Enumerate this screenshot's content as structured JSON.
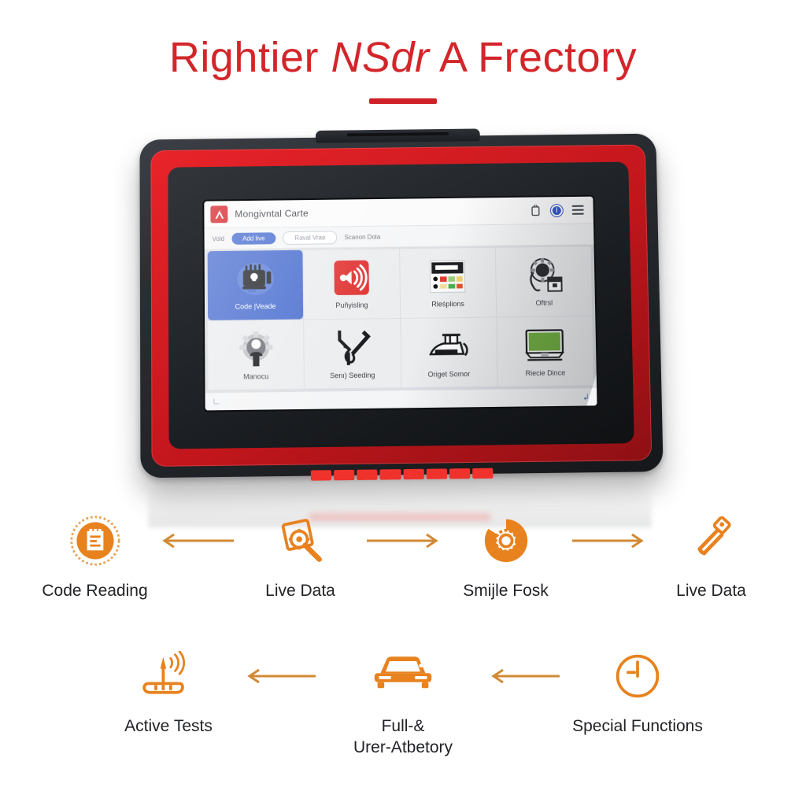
{
  "header": {
    "title_part1": "Rightier ",
    "title_italic": "NSdr",
    "title_part2": " A Frectory",
    "title_full": "Rightier NSdr A Frectory",
    "accent_color": "#d2262a"
  },
  "device": {
    "body_color": "#25282c",
    "trim_color": "#d8232a"
  },
  "app": {
    "logo_name": "brand-logo",
    "title": "Mongivntal Carte",
    "toolbar": [
      {
        "name": "clipboard-icon",
        "label": "clipboard"
      },
      {
        "name": "power-icon",
        "label": "power"
      },
      {
        "name": "menu-icon",
        "label": "menu"
      }
    ],
    "tabbar": {
      "lead_label": "Vold",
      "active_tab": "Add live",
      "ghost_tab": "Raval Vrae",
      "plain_tab": "Scanon Dola"
    },
    "tiles": [
      {
        "label": "Code |Veade",
        "icon": "ecu-module-icon",
        "selected": true
      },
      {
        "label": "Puñyisling",
        "icon": "broadcast-icon",
        "selected": false
      },
      {
        "label": "Rleśplions",
        "icon": "fuse-panel-icon",
        "selected": false
      },
      {
        "label": "Oftrsl",
        "icon": "fan-tool-icon",
        "selected": false
      },
      {
        "label": "Manocu",
        "icon": "gear-person-icon",
        "selected": false
      },
      {
        "label": "Senı) Seeding",
        "icon": "wrench-icon",
        "selected": false
      },
      {
        "label": "Origet Somor",
        "icon": "car-sensor-icon",
        "selected": false
      },
      {
        "label": "Riecie Dince",
        "icon": "monitor-icon",
        "selected": false
      }
    ],
    "statusbar": {
      "left_icon": "corner-left-icon",
      "right_icon": "enter-return-icon"
    }
  },
  "flow": {
    "accent_color": "#e8821e",
    "row1": [
      {
        "label": "Code Reading",
        "icon": "code-badge-icon"
      },
      {
        "arrow": "arrow-left"
      },
      {
        "label": "Live Data",
        "icon": "magnifier-gear-icon"
      },
      {
        "arrow": "arrow-right"
      },
      {
        "label": "Smijle Fosk",
        "icon": "gear-settings-icon"
      },
      {
        "arrow": "arrow-right"
      },
      {
        "label": "Live Data",
        "icon": "screwdriver-icon"
      }
    ],
    "row2": [
      {
        "label": "Active Tests",
        "icon": "antenna-signal-icon"
      },
      {
        "arrow": "arrow-left"
      },
      {
        "label_line1": "Full-&",
        "label_line2": "Urer-Atbetory",
        "icon": "car-icon"
      },
      {
        "arrow": "arrow-left"
      },
      {
        "label": "Special Functions",
        "icon": "clock-gauge-icon"
      }
    ]
  }
}
